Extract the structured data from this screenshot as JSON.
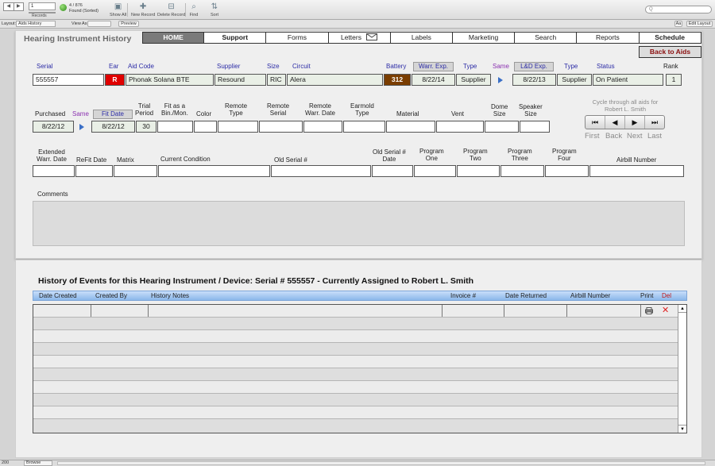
{
  "toolbar": {
    "record_value": "1",
    "records_label": "Records",
    "found_count": "4 / 876",
    "found_label": "Found (Sorted)",
    "show_all": "Show All",
    "new_record": "New Record",
    "delete_record": "Delete Record",
    "find": "Find",
    "sort": "Sort",
    "search_placeholder": "Q"
  },
  "layoutbar": {
    "layout_label": "Layout:",
    "layout_value": "Aids History",
    "view_as": "View As:",
    "preview": "Preview",
    "aa": "Aa",
    "edit_layout": "Edit Layout"
  },
  "header": {
    "title": "Hearing Instrument History",
    "tabs": [
      "HOME",
      "Support",
      "Forms",
      "Letters",
      "Labels",
      "Marketing",
      "Search",
      "Reports",
      "Schedule"
    ],
    "back_to_aids": "Back to Aids"
  },
  "row1": {
    "labels": {
      "serial": "Serial",
      "ear": "Ear",
      "aid_code": "Aid Code",
      "supplier": "Supplier",
      "size": "Size",
      "circuit": "Circuit",
      "battery": "Battery",
      "warr_exp": "Warr. Exp.",
      "type": "Type",
      "same": "Same",
      "ld_exp": "L&D  Exp.",
      "type2": "Type",
      "status": "Status",
      "rank": "Rank"
    },
    "values": {
      "serial": "555557",
      "ear": "R",
      "aid_code": "Phonak Solana BTE",
      "supplier": "Resound",
      "size": "RIC",
      "circuit": "Alera",
      "battery": "312",
      "warr_exp": "8/22/14",
      "type": "Supplier",
      "ld_exp": "8/22/13",
      "type2": "Supplier",
      "status": "On Patient",
      "rank": "1"
    }
  },
  "row2": {
    "labels": {
      "purchased": "Purchased",
      "same": "Same",
      "fit_date": "Fit Date",
      "trial_period": "Trial\nPeriod",
      "fit_as": "Fit as a\nBin./Mon.",
      "color": "Color",
      "remote_type": "Remote\nType",
      "remote_serial": "Remote\nSerial",
      "remote_warr": "Remote\nWarr. Date",
      "earmold_type": "Earmold\nType",
      "material": "Material",
      "vent": "Vent",
      "dome_size": "Dome\nSize",
      "speaker_size": "Speaker\nSize"
    },
    "values": {
      "purchased": "8/22/12",
      "fit_date": "8/22/12",
      "trial_period": "30"
    }
  },
  "cycle": {
    "caption": "Cycle through all aids for\nRobert L. Smith",
    "buttons": [
      "First",
      "Back",
      "Next",
      "Last"
    ]
  },
  "row3": {
    "labels": {
      "ext_warr": "Extended\nWarr. Date",
      "refit": "ReFit Date",
      "matrix": "Matrix",
      "condition": "Current Condition",
      "old_serial": "Old Serial #",
      "old_serial_date": "Old Serial #\nDate",
      "prog1": "Program\nOne",
      "prog2": "Program\nTwo",
      "prog3": "Program\nThree",
      "prog4": "Program\nFour",
      "airbill": "Airbill Number"
    }
  },
  "comments": {
    "label": "Comments"
  },
  "history": {
    "title": "History of Events for this Hearing Instrument / Device: Serial # 555557    -    Currently Assigned to Robert L. Smith",
    "columns": {
      "date_created": "Date Created",
      "created_by": "Created By",
      "history_notes": "History Notes",
      "invoice": "Invoice #",
      "date_returned": "Date Returned",
      "airbill": "Airbill Number",
      "print": "Print",
      "del": "Del"
    }
  },
  "statusbar": {
    "zoom": "200",
    "mode": "Browse"
  },
  "colors": {
    "home_tab": "#7a7a7a",
    "ear_red": "#e00000",
    "battery_brown": "#7a3d00",
    "label_blue": "#2c2ca6",
    "header_bar": "#8bb7ea"
  },
  "icons": [
    "print-icon",
    "delete-icon",
    "envelope-icon",
    "triangle-right-icon"
  ]
}
